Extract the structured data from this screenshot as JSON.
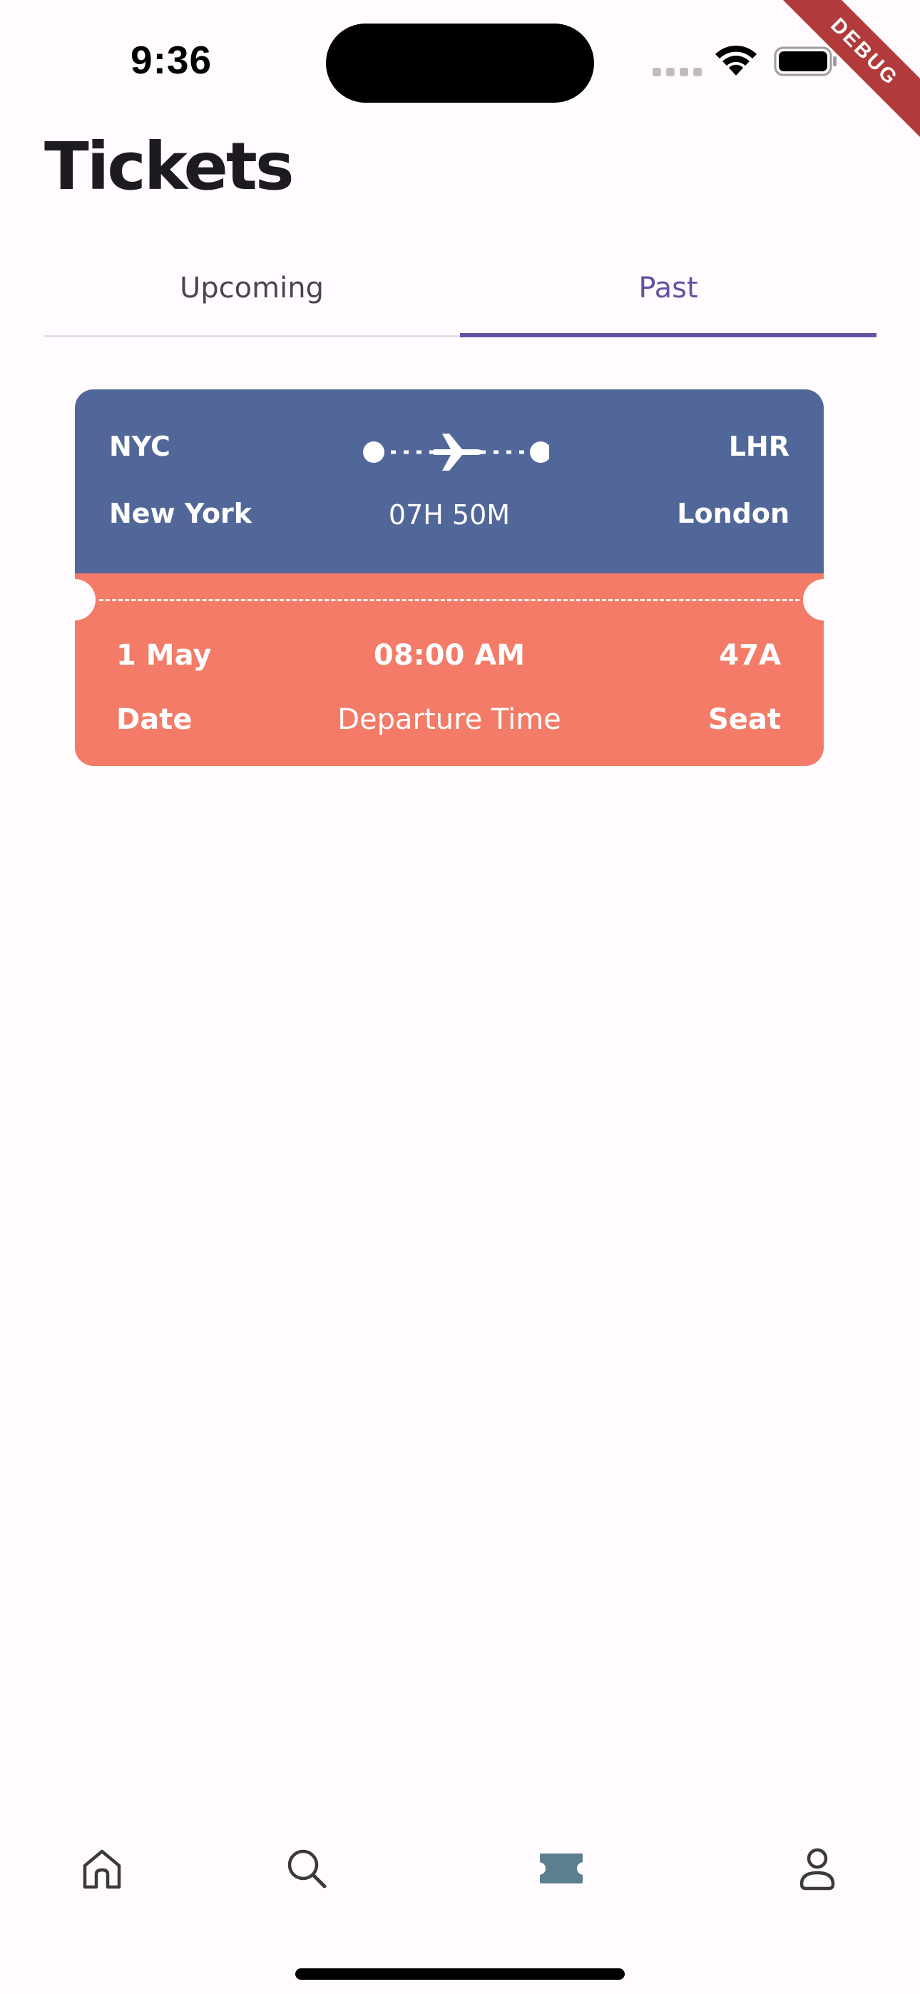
{
  "status_bar": {
    "time": "9:36",
    "debug_label": "DEBUG"
  },
  "header": {
    "title": "Tickets"
  },
  "tabs": [
    {
      "label": "Upcoming",
      "selected": false
    },
    {
      "label": "Past",
      "selected": true
    }
  ],
  "ticket": {
    "from_code": "NYC",
    "to_code": "LHR",
    "from_city": "New York",
    "to_city": "London",
    "duration": "07H 50M",
    "date_value": "1 May",
    "date_label": "Date",
    "departure_value": "08:00 AM",
    "departure_label": "Departure Time",
    "seat_value": "47A",
    "seat_label": "Seat",
    "top_color": "#526799",
    "bottom_color": "#F37B67"
  },
  "bottom_nav": {
    "items": [
      {
        "icon": "home-icon",
        "selected": false
      },
      {
        "icon": "search-icon",
        "selected": false
      },
      {
        "icon": "ticket-icon",
        "selected": true
      },
      {
        "icon": "profile-icon",
        "selected": false
      }
    ],
    "active_color": "#5B7F8E",
    "inactive_color": "#3A3A3A"
  },
  "colors": {
    "background": "#FFFBFE",
    "accent": "#6750A4"
  }
}
